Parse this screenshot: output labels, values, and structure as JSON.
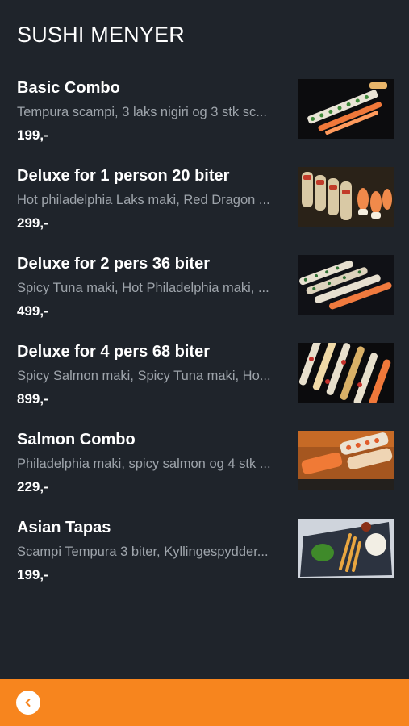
{
  "header": {
    "title": "SUSHI MENYER"
  },
  "items": [
    {
      "name": "Basic Combo",
      "description": "Tempura scampi, 3 laks nigiri og 3 stk sc...",
      "price": "199,-",
      "image": "sushi-combo-image"
    },
    {
      "name": "Deluxe for 1 person 20 biter",
      "description": "Hot philadelphia Laks maki, Red Dragon ...",
      "price": "299,-",
      "image": "sushi-platter-image"
    },
    {
      "name": "Deluxe for 2 pers 36 biter",
      "description": "Spicy Tuna maki, Hot Philadelphia maki, ...",
      "price": "499,-",
      "image": "sushi-platter-image"
    },
    {
      "name": "Deluxe for 4 pers 68 biter",
      "description": "Spicy Salmon maki, Spicy Tuna maki, Ho...",
      "price": "899,-",
      "image": "sushi-platter-image"
    },
    {
      "name": "Salmon Combo",
      "description": "Philadelphia maki, spicy salmon og 4 stk ...",
      "price": "229,-",
      "image": "salmon-rolls-image"
    },
    {
      "name": "Asian Tapas",
      "description": "Scampi Tempura 3 biter, Kyllingespydder...",
      "price": "199,-",
      "image": "tapas-plate-image"
    }
  ],
  "footer": {
    "back_icon": "chevron-left-icon"
  },
  "colors": {
    "background": "#1f242b",
    "accent": "#f7851e",
    "description": "#9ea4ab"
  }
}
